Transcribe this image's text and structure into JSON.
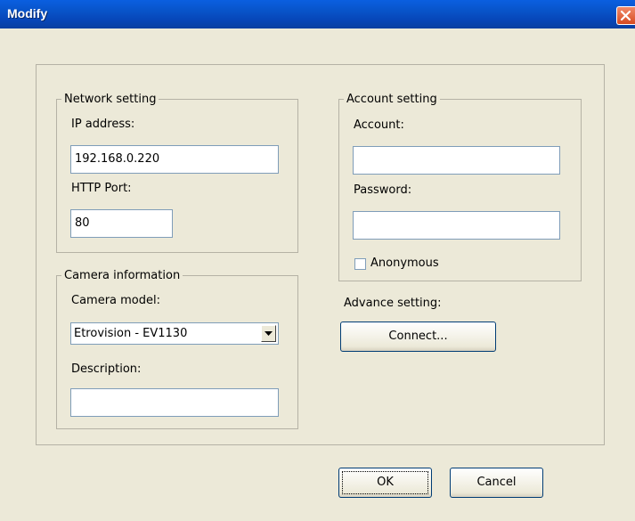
{
  "window": {
    "title": "Modify"
  },
  "network": {
    "legend": "Network setting",
    "ip_label": "IP address:",
    "ip_value": "192.168.0.220",
    "port_label": "HTTP Port:",
    "port_value": "80"
  },
  "account": {
    "legend": "Account setting",
    "account_label": "Account:",
    "account_value": "",
    "password_label": "Password:",
    "password_value": "",
    "anonymous_label": "Anonymous",
    "anonymous_checked": false
  },
  "camera": {
    "legend": "Camera information",
    "model_label": "Camera model:",
    "model_value": "Etrovision - EV1130",
    "description_label": "Description:",
    "description_value": ""
  },
  "advance": {
    "label": "Advance setting:",
    "connect_label": "Connect..."
  },
  "buttons": {
    "ok_label": "OK",
    "cancel_label": "Cancel"
  },
  "icons": {
    "close": "close-icon",
    "dropdown": "chevron-down-icon"
  },
  "colors": {
    "titlebar": "#0853c8",
    "dialog_bg": "#ece9d8",
    "close_button": "#d84a20"
  }
}
